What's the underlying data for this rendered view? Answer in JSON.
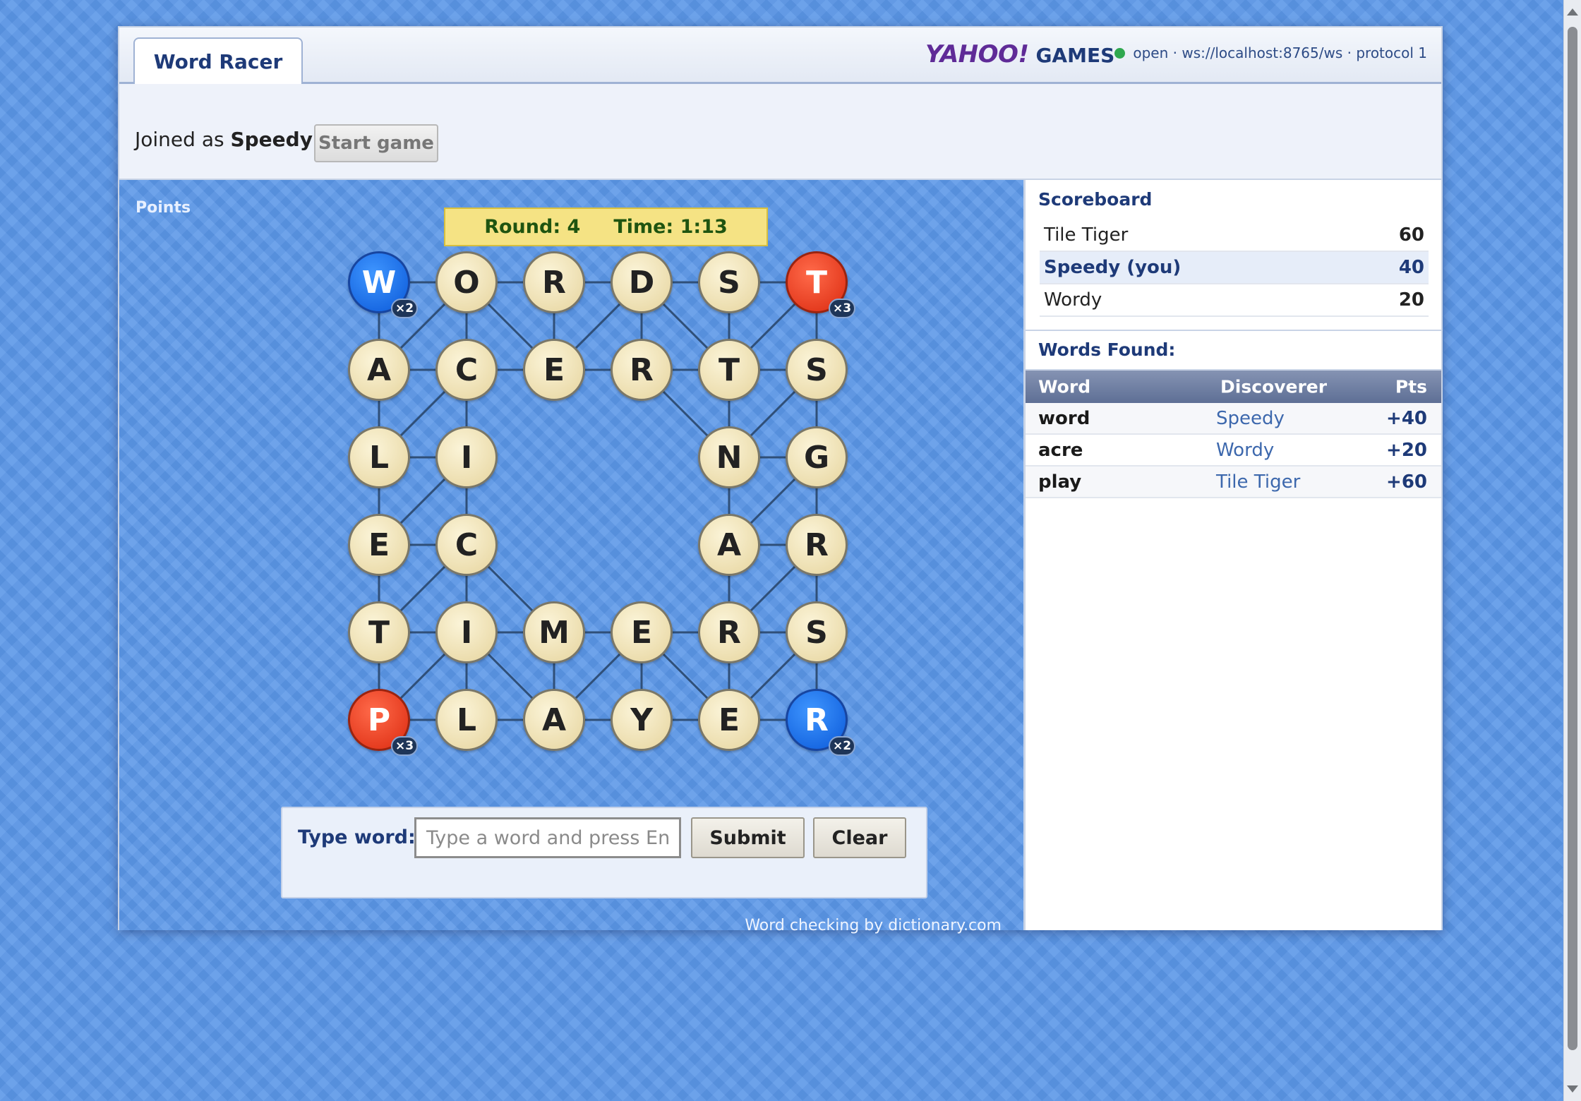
{
  "tab": {
    "label": "Word Racer"
  },
  "logo": {
    "yahoo": "YAHOO!",
    "games": "GAMES"
  },
  "connection": {
    "text": "open · ws://localhost:8765/ws · protocol 1",
    "status_color": "#2fa84f"
  },
  "join": {
    "prefix": "Joined as",
    "name": "Speedy",
    "start_label": "Start game"
  },
  "board": {
    "points_label": "Points",
    "round_text": "Round: 4",
    "time_text": "Time: 1:13",
    "tiles": [
      {
        "letter": "W",
        "mult": "×2",
        "style": "blue"
      },
      {
        "letter": "O"
      },
      {
        "letter": "R"
      },
      {
        "letter": "D"
      },
      {
        "letter": "S"
      },
      {
        "letter": "T",
        "mult": "×3",
        "style": "red"
      },
      {
        "letter": "A"
      },
      {
        "letter": "C"
      },
      {
        "letter": "E"
      },
      {
        "letter": "R"
      },
      {
        "letter": "T"
      },
      {
        "letter": "S"
      },
      {
        "letter": "L"
      },
      {
        "letter": "I"
      },
      {
        "letter": ""
      },
      {
        "letter": ""
      },
      {
        "letter": "N"
      },
      {
        "letter": "G"
      },
      {
        "letter": "E"
      },
      {
        "letter": "C"
      },
      {
        "letter": ""
      },
      {
        "letter": ""
      },
      {
        "letter": "A"
      },
      {
        "letter": "R"
      },
      {
        "letter": "T"
      },
      {
        "letter": "I"
      },
      {
        "letter": "M"
      },
      {
        "letter": "E"
      },
      {
        "letter": "R"
      },
      {
        "letter": "S"
      },
      {
        "letter": "P",
        "mult": "×3",
        "style": "red"
      },
      {
        "letter": "L"
      },
      {
        "letter": "A"
      },
      {
        "letter": "Y"
      },
      {
        "letter": "E"
      },
      {
        "letter": "R",
        "mult": "×2",
        "style": "blue"
      }
    ]
  },
  "word_entry": {
    "label": "Type word:",
    "placeholder": "Type a word and press Enter",
    "submit_label": "Submit",
    "clear_label": "Clear"
  },
  "credit": "Word checking by dictionary.com",
  "scoreboard": {
    "title": "Scoreboard",
    "rows": [
      {
        "name": "Tile Tiger",
        "score": "60"
      },
      {
        "name": "Speedy (you)",
        "score": "40"
      },
      {
        "name": "Wordy",
        "score": "20"
      }
    ]
  },
  "words_found": {
    "title": "Words Found:",
    "headers": {
      "word": "Word",
      "discoverer": "Discoverer",
      "pts": "Pts"
    },
    "rows": [
      {
        "word": "word",
        "discoverer": "Speedy",
        "pts": "+40"
      },
      {
        "word": "acre",
        "discoverer": "Wordy",
        "pts": "+20"
      },
      {
        "word": "play",
        "discoverer": "Tile Tiger",
        "pts": "+60"
      }
    ]
  }
}
